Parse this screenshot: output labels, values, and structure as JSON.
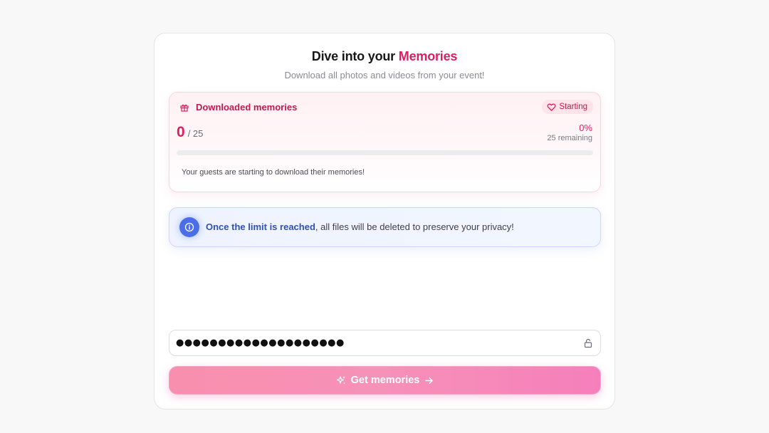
{
  "header": {
    "title_prefix": "Dive into your",
    "title_accent": "Memories",
    "subtitle": "Download all photos and videos from your event!"
  },
  "progress": {
    "label": "Downloaded memories",
    "status": "Starting",
    "current": "0",
    "total": "/ 25",
    "percent_text": "0%",
    "remaining": "25 remaining",
    "fraction": 0,
    "message": "Your guests are starting to download their memories!",
    "icons": {
      "label": "gift-icon",
      "status": "heart-icon"
    }
  },
  "info": {
    "strong": "Once the limit is reached",
    "rest": ", all files will be deleted to preserve your privacy!",
    "icon": "info-icon"
  },
  "password": {
    "value": "●●●●●●●●●●●●●●●●●●●●",
    "icon": "lock-icon"
  },
  "submit": {
    "label": "Get memories",
    "icons": [
      "sparkles-icon",
      "arrow-right-icon"
    ]
  },
  "colors": {
    "accent": "#e11d62",
    "info_accent": "#2f4fb8",
    "button_gradient_start": "#f98fae",
    "button_gradient_end": "#f57fbb"
  }
}
